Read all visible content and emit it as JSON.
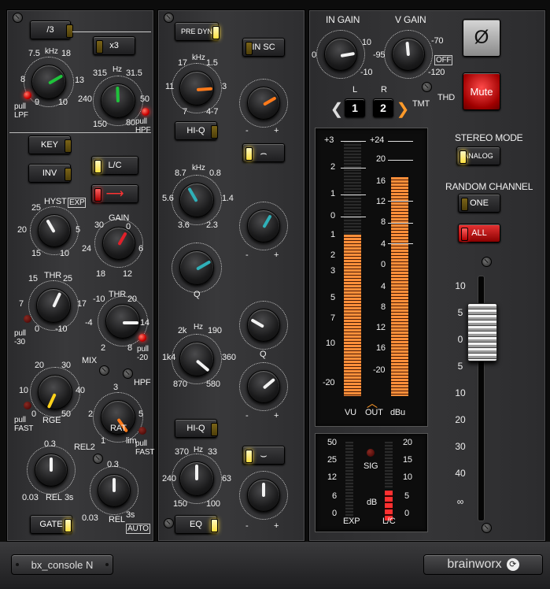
{
  "filter": {
    "div3_button": "/3",
    "x3_button": "x3",
    "lpf": {
      "unit": "kHz",
      "scale": [
        "7.5",
        "18",
        "8",
        "13",
        "9",
        "10"
      ],
      "pull_label": "pull\nLPF"
    },
    "hpf": {
      "unit": "Hz",
      "scale": [
        "315",
        "31.5",
        "240",
        "50",
        "150",
        "80"
      ],
      "pull_label": "pull\nHPF"
    }
  },
  "dynamics": {
    "key_button": "KEY",
    "inv_button": "INV",
    "lc_button": "L/C",
    "hyst": {
      "label": "HYST",
      "exp_tag": "EXP",
      "scale": [
        "25",
        "5",
        "20",
        "5",
        "15",
        "10"
      ]
    },
    "gain": {
      "label": "GAIN",
      "scale": [
        "30",
        "0",
        "24",
        "6",
        "18",
        "12"
      ]
    },
    "gate_thr": {
      "label": "THR",
      "scale": [
        "15",
        "25",
        "7",
        "17",
        "0",
        "-10"
      ],
      "pull": "pull\n-30"
    },
    "comp_thr": {
      "label": "THR",
      "scale": [
        "-10",
        "20",
        "-4",
        "14",
        "2",
        "8"
      ],
      "pull": "pull\n-20"
    },
    "mix_label": "MIX",
    "hpf_label": "HPF",
    "rge": {
      "label": "RGE",
      "scale": [
        "20",
        "30",
        "10",
        "40",
        "0",
        "50"
      ],
      "pull": "pull\nFAST"
    },
    "rat": {
      "label": "RAT",
      "scale": [
        "3",
        "2",
        "5",
        "1",
        "lim"
      ],
      "pull": "pull\nFAST"
    },
    "rel_left": {
      "label": "REL",
      "scale": [
        "0.3",
        "0.03",
        "3s"
      ]
    },
    "rel2": {
      "label": "REL2",
      "rel": "REL",
      "scale": [
        "0.3",
        "0.03",
        "3s"
      ],
      "auto_tag": "AUTO"
    },
    "gate_button": "GATE"
  },
  "eq": {
    "pre_dyn_button": "PRE DYN",
    "in_sc_button": "IN SC",
    "high": {
      "unit": "kHz",
      "scale": [
        "17",
        "1.5",
        "11",
        "3",
        "7",
        "4-7"
      ]
    },
    "hiq_button": "HI-Q",
    "hmid": {
      "unit": "kHz",
      "scale": [
        "8.7",
        "0.8",
        "5.6",
        "1.4",
        "3.6",
        "2.3"
      ]
    },
    "hmid_q_label": "Q",
    "lmid": {
      "unit": "Hz",
      "scale": [
        "2k",
        "190",
        "1k4",
        "360",
        "870",
        "580"
      ]
    },
    "lmid_q_label": "Q",
    "low": {
      "unit": "Hz",
      "scale": [
        "370",
        "33",
        "240",
        "63",
        "150",
        "100"
      ]
    },
    "low_hiq_button": "HI-Q",
    "eq_button": "EQ",
    "gain_sign": [
      "-",
      "+"
    ]
  },
  "output": {
    "in_gain": {
      "label": "IN GAIN",
      "scale": [
        "10",
        "0",
        "-10"
      ]
    },
    "v_gain": {
      "label": "V GAIN",
      "scale": [
        "-70",
        "-95",
        "-120"
      ],
      "off_tag": "OFF"
    },
    "channel_l": "L",
    "channel_r": "R",
    "channel_1": "1",
    "channel_2": "2",
    "tmt_label": "TMT",
    "thd_label": "THD",
    "phase_symbol": "Ø",
    "mute_button": "Mute",
    "stereo_mode_label": "STEREO MODE",
    "analog_button": "ANALOG",
    "random_channel_label": "RANDOM CHANNEL",
    "one_button": "ONE",
    "all_button": "ALL",
    "vu_meter": {
      "vu_scale": [
        "+3",
        "2",
        "1",
        "0",
        "1",
        "2",
        "3",
        "5",
        "7",
        "10",
        "-20"
      ],
      "dbu_scale": [
        "+24",
        "20",
        "16",
        "12",
        "8",
        "4",
        "0",
        "4",
        "8",
        "12",
        "16",
        "-20"
      ],
      "labels": [
        "VU",
        "OUT",
        "dBu"
      ],
      "level_left_vu": -1,
      "level_right_dbu": 16
    },
    "dyn_meter": {
      "exp_scale": [
        "50",
        "25",
        "12",
        "6",
        "0"
      ],
      "lc_scale": [
        "20",
        "15",
        "10",
        "5",
        "0"
      ],
      "sig_label": "SIG",
      "db_label": "dB",
      "exp_label": "EXP",
      "lc_label": "L/C"
    },
    "fader_scale": [
      "10",
      "5",
      "0",
      "5",
      "10",
      "20",
      "30",
      "40",
      "∞"
    ],
    "fader_value": 0
  },
  "footer": {
    "plugin_name": "bx_console N",
    "brand": "brainworx"
  },
  "colors": {
    "green": "#1fc23b",
    "red": "#e0202a",
    "orange": "#ff7a1a",
    "teal": "#2fb0b8",
    "yellow": "#ffd21a",
    "white": "#f2f2f2",
    "meter_orange": "#ff8f3a"
  }
}
